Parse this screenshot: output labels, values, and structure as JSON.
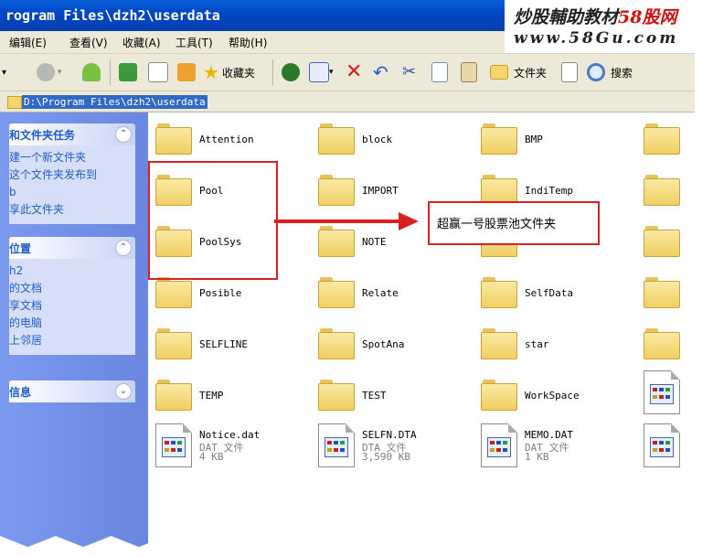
{
  "window": {
    "title": "rogram Files\\dzh2\\userdata"
  },
  "watermark": {
    "line1": "炒股輔助教材",
    "line1_red": "58股网",
    "line2": "www.58Gu.com"
  },
  "menu": [
    "编辑(E)",
    "查看(V)",
    "收藏(A)",
    "工具(T)",
    "帮助(H)"
  ],
  "toolbar": {
    "favorites_label": "收藏夹",
    "folders_label": "文件夹",
    "search_label": "搜索"
  },
  "address": {
    "value": "D:\\Program Files\\dzh2\\userdata"
  },
  "sidebar": {
    "tasks": {
      "title": "和文件夹任务",
      "items": [
        "建一个新文件夹",
        "这个文件夹发布到",
        "b",
        "享此文件夹"
      ]
    },
    "places": {
      "title": "位置",
      "items": [
        "h2",
        "的文档",
        "享文档",
        "的电脑",
        "上邻居"
      ]
    },
    "details": {
      "title": "信息"
    }
  },
  "folders": [
    [
      "Attention",
      "block",
      "BMP"
    ],
    [
      "Pool",
      "IMPORT",
      "IndiTemp"
    ],
    [
      "PoolSys",
      "NOTE",
      ""
    ],
    [
      "Posible",
      "Relate",
      "SelfData"
    ],
    [
      "SELFLINE",
      "SpotAna",
      "star"
    ],
    [
      "TEMP",
      "TEST",
      "WorkSpace"
    ]
  ],
  "files": [
    {
      "name": "Notice.dat",
      "type": "DAT 文件",
      "size": "4 KB"
    },
    {
      "name": "SELFN.DTA",
      "type": "DTA 文件",
      "size": "3,590 KB"
    },
    {
      "name": "MEMO.DAT",
      "type": "DAT 文件",
      "size": "1 KB"
    }
  ],
  "annotation": {
    "text": "超赢一号股票池文件夹"
  },
  "colors": {
    "accent_red": "#d92020",
    "selection": "#316ac5"
  }
}
